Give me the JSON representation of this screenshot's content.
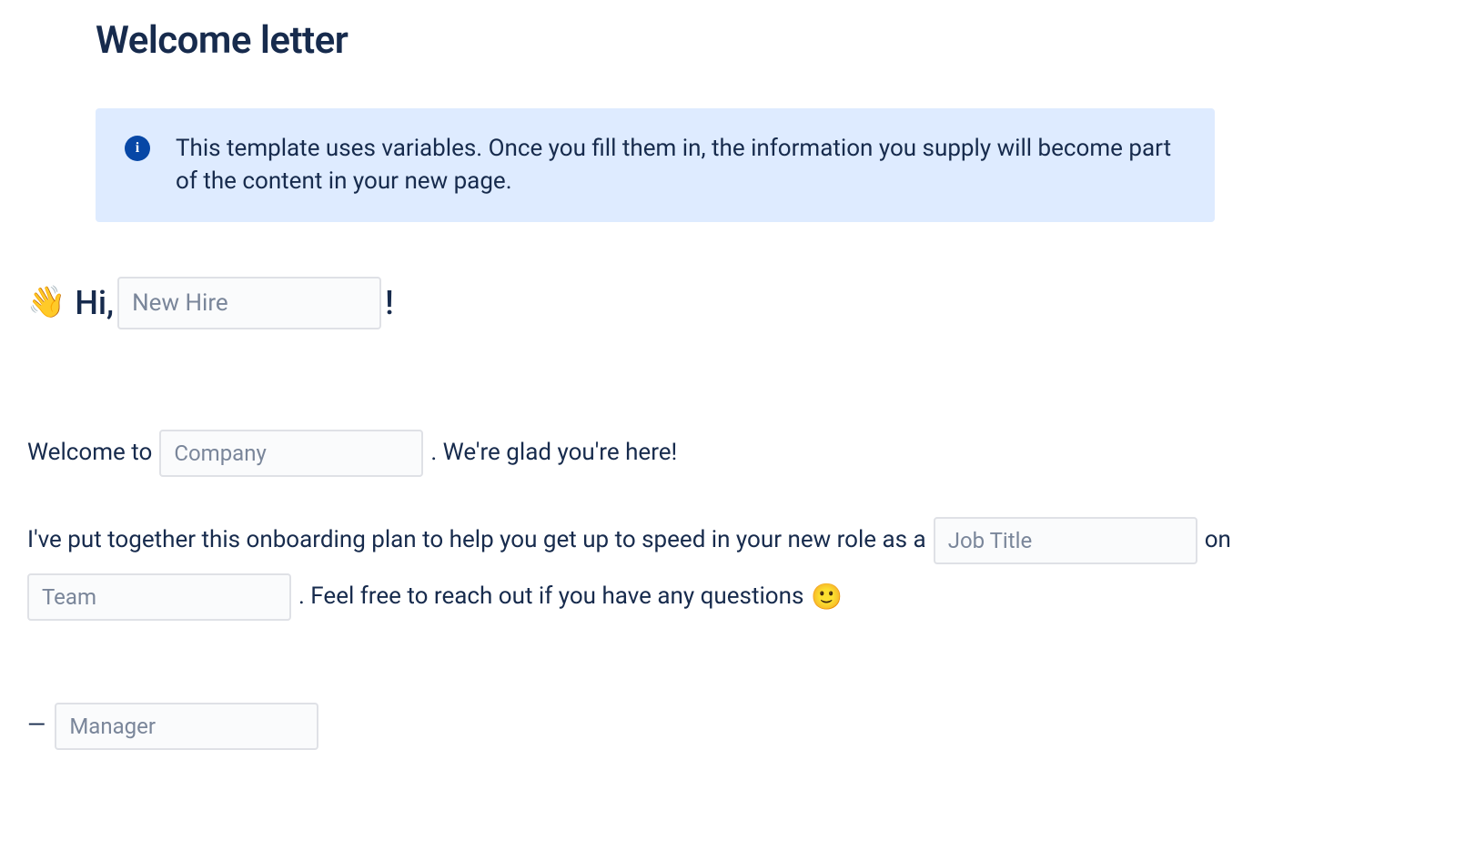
{
  "title": "Welcome letter",
  "info_panel": {
    "icon_label": "i",
    "text": "This template uses variables. Once you fill them in, the information you supply will become part of the content in your new page."
  },
  "greeting": {
    "wave_emoji": "👋",
    "hi_text": "Hi,",
    "new_hire_placeholder": "New Hire",
    "exclaim": "!"
  },
  "body": {
    "welcome_to": "Welcome to",
    "company_placeholder": "Company",
    "after_company": ". We're glad you're here!",
    "sentence2": "I've put together this onboarding plan to help you get up to speed in your new role as a",
    "job_title_placeholder": "Job Title",
    "on_text": "on",
    "team_placeholder": "Team",
    "after_team": ". Feel free to reach out if you have any questions",
    "smile_emoji": "🙂"
  },
  "signature": {
    "dash": "—",
    "manager_placeholder": "Manager"
  }
}
